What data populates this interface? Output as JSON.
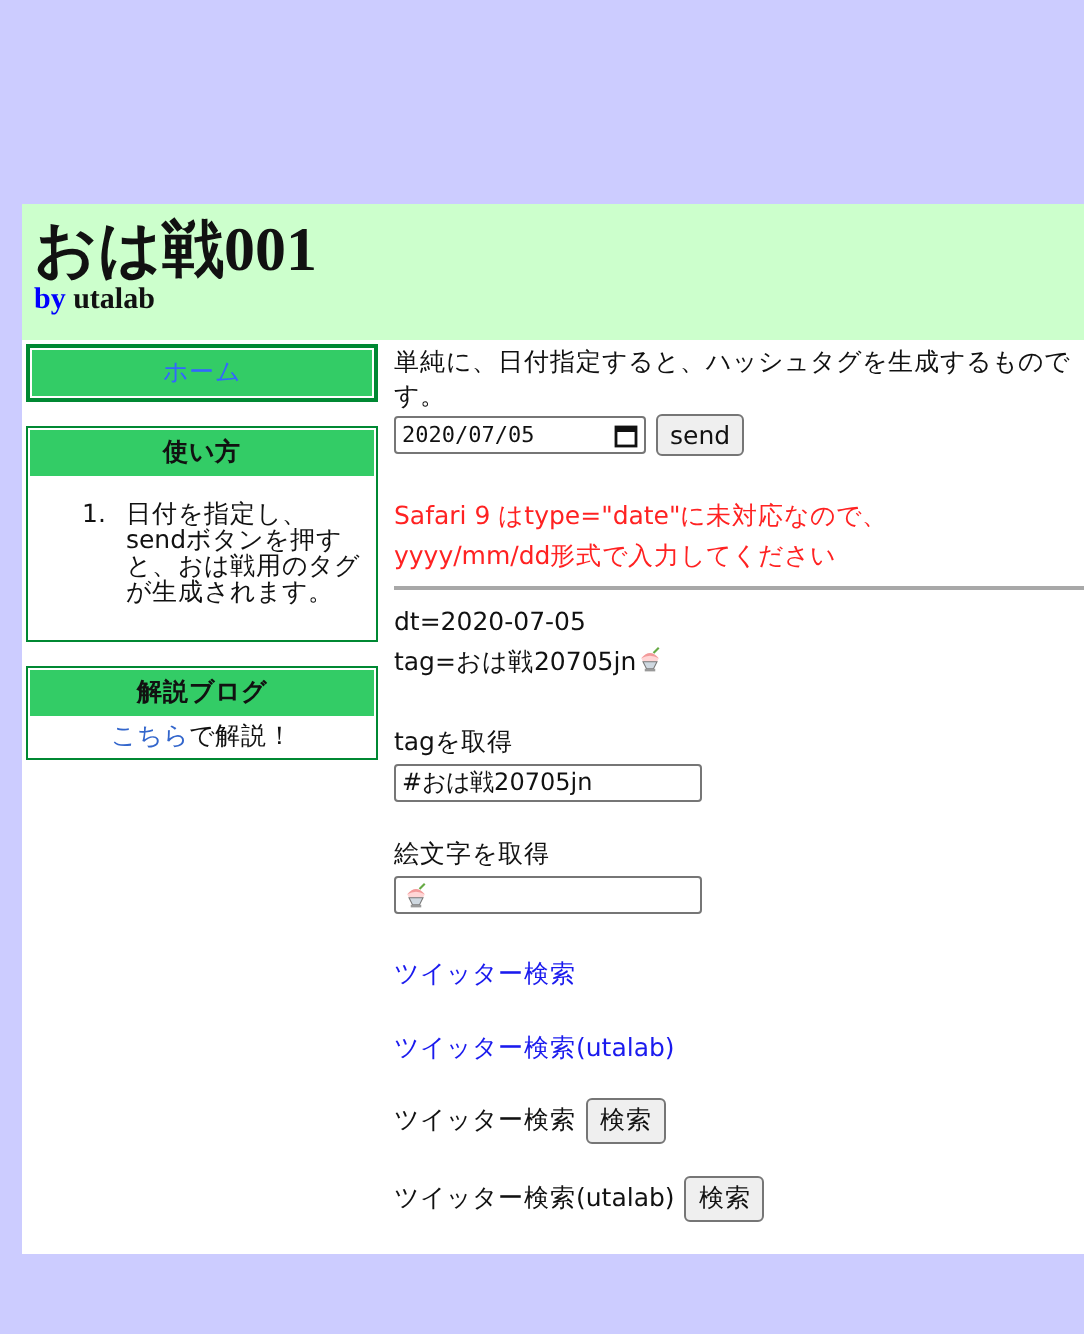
{
  "header": {
    "title": "おは戦**001**",
    "byline_prefix": "by",
    "byline_author": "utalab"
  },
  "sidebar": {
    "home": "ホーム",
    "usage": {
      "title": "使い方",
      "steps": [
        {
          "number": "1.",
          "text": "日付を指定し、sendボタンを押すと、おは戦用のタグが生成されます。"
        }
      ]
    },
    "blog": {
      "title": "解説ブログ",
      "link": "こちら",
      "suffix": "で解説！"
    }
  },
  "content": {
    "intro": "単純に、日付指定すると、ハッシュタグを生成するものです。",
    "date_field": {
      "value": "2020/07/05"
    },
    "send_button": "send",
    "notice": [
      "Safari 9 はtype=\"date\"に未対応なので、",
      "yyyy/mm/dd形式で入力してください"
    ],
    "dt": "dt=2020-07-05",
    "tag": "tag=おは戦20705jn",
    "tag_label": "tagを取得",
    "tag_field": {
      "value": "#おは戦20705jn"
    },
    "emoji_label": "絵文字を取得",
    "links": [
      "ツイッター検索",
      "ツイッター検索(utalab)"
    ],
    "search_rows": [
      {
        "label": "ツイッター検索",
        "button": "検索"
      },
      {
        "label": "ツイッター検索(utalab)",
        "button": "検索"
      }
    ]
  }
}
